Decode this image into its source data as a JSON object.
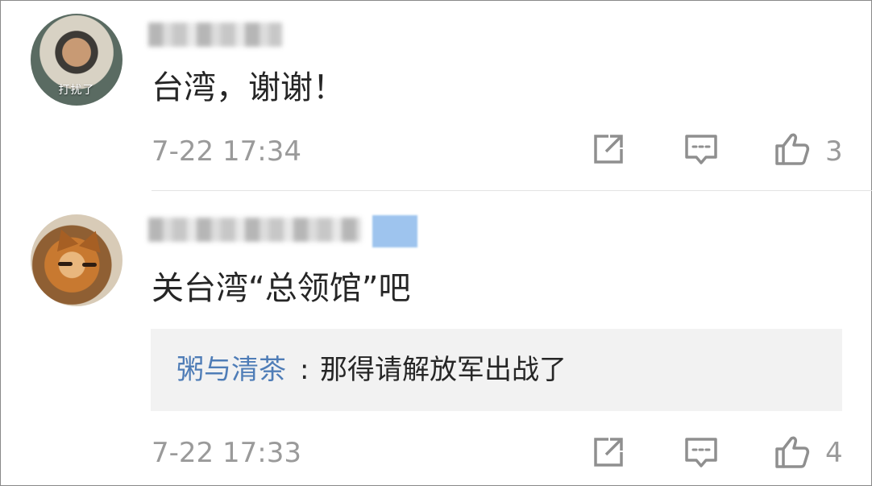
{
  "comments": [
    {
      "avatar_caption": "打扰了",
      "text": "台湾，谢谢！",
      "time": "7-22 17:34",
      "likes": "3"
    },
    {
      "text": "关台湾“总领馆”吧",
      "reply": {
        "author": "粥与清茶",
        "separator": ":",
        "text": "那得请解放军出战了"
      },
      "time": "7-22 17:33",
      "likes": "4"
    }
  ],
  "icons": [
    "share-icon",
    "comment-icon",
    "thumbs-up-icon"
  ],
  "colors": {
    "text": "#262626",
    "muted": "#9a9a9a",
    "link": "#4f7db7",
    "reply_background": "#f2f2f2"
  }
}
